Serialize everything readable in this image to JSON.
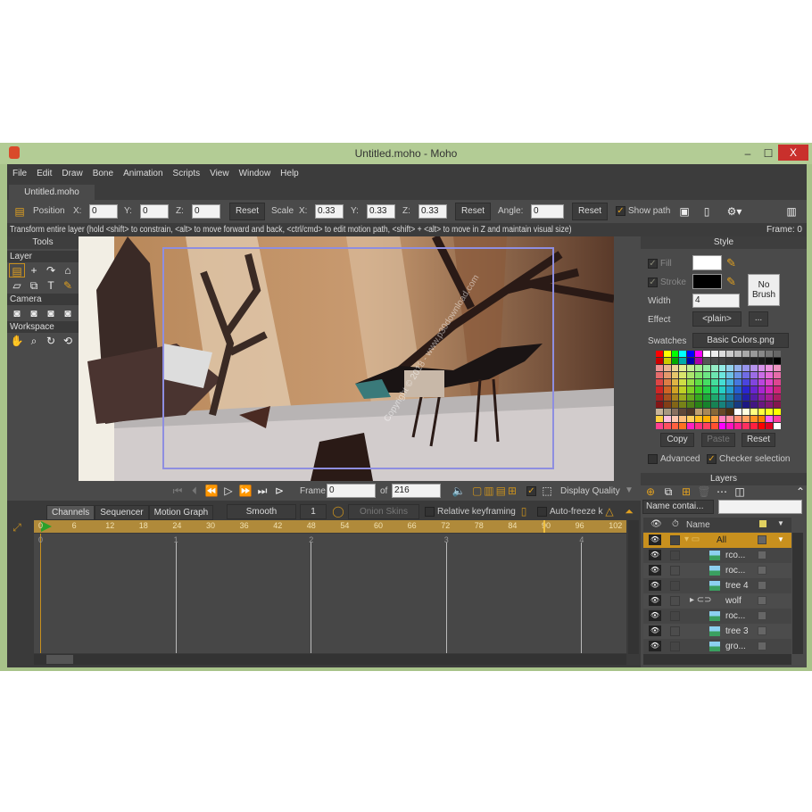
{
  "window": {
    "title": "Untitled.moho - Moho",
    "min": "–",
    "max": "☐",
    "close": "X"
  },
  "menu": [
    "File",
    "Edit",
    "Draw",
    "Bone",
    "Animation",
    "Scripts",
    "View",
    "Window",
    "Help"
  ],
  "doc_tab": "Untitled.moho",
  "toolbar": {
    "position": "Position",
    "x_label": "X:",
    "y_label": "Y:",
    "z_label": "Z:",
    "pos_x": "0",
    "pos_y": "0",
    "pos_z": "0",
    "reset": "Reset",
    "scale": "Scale",
    "scale_x": "0.33",
    "scale_y": "0.33",
    "scale_z": "0.33",
    "angle": "Angle:",
    "angle_val": "0",
    "show_path": "Show path",
    "show_path_checked": true
  },
  "status": {
    "hint": "Transform entire layer (hold <shift> to constrain, <alt> to move forward and back, <ctrl/cmd> to edit motion path, <shift> + <alt> to move in Z and maintain visual size)",
    "frame": "Frame: 0"
  },
  "tools": {
    "title": "Tools",
    "layer": "Layer",
    "camera": "Camera",
    "workspace": "Workspace"
  },
  "playback": {
    "frame_label": "Frame",
    "frame": "0",
    "of": "of",
    "total": "216",
    "display_quality": "Display Quality"
  },
  "timeline": {
    "tabs": [
      "Channels",
      "Sequencer",
      "Motion Graph"
    ],
    "interp": "Smooth",
    "step": "1",
    "onion": "Onion Skins",
    "relative": "Relative keyframing",
    "autofreeze": "Auto-freeze k",
    "ruler": [
      "0",
      "6",
      "12",
      "18",
      "24",
      "30",
      "36",
      "42",
      "48",
      "54",
      "60",
      "66",
      "72",
      "78",
      "84",
      "90",
      "96",
      "102"
    ],
    "seconds": [
      "0",
      "1",
      "2",
      "3",
      "4"
    ]
  },
  "style": {
    "title": "Style",
    "fill": "Fill",
    "stroke": "Stroke",
    "width": "Width",
    "width_val": "4",
    "effect": "Effect",
    "effect_val": "<plain>",
    "more": "...",
    "no_brush": "No Brush",
    "swatches": "Swatches",
    "swatch_file": "Basic Colors.png",
    "copy": "Copy",
    "paste": "Paste",
    "reset": "Reset",
    "advanced": "Advanced",
    "checker": "Checker selection",
    "checker_checked": true,
    "fill_color": "#ffffff",
    "stroke_color": "#000000"
  },
  "layers": {
    "title": "Layers",
    "filter": "Name contai...",
    "name_col": "Name",
    "items": [
      {
        "name": "All",
        "type": "folder",
        "selected": true
      },
      {
        "name": "rco...",
        "type": "image"
      },
      {
        "name": "roc...",
        "type": "image"
      },
      {
        "name": "tree 4",
        "type": "image"
      },
      {
        "name": "wolf",
        "type": "bone"
      },
      {
        "name": "roc...",
        "type": "image"
      },
      {
        "name": "tree 3",
        "type": "image"
      },
      {
        "name": "gro...",
        "type": "image"
      }
    ]
  },
  "colors": {
    "accent": "#c8901e",
    "panel": "#4a4a4a",
    "title_bar": "#b3cc95"
  },
  "watermark": "Copyright © 2018 - www.p30download.com"
}
